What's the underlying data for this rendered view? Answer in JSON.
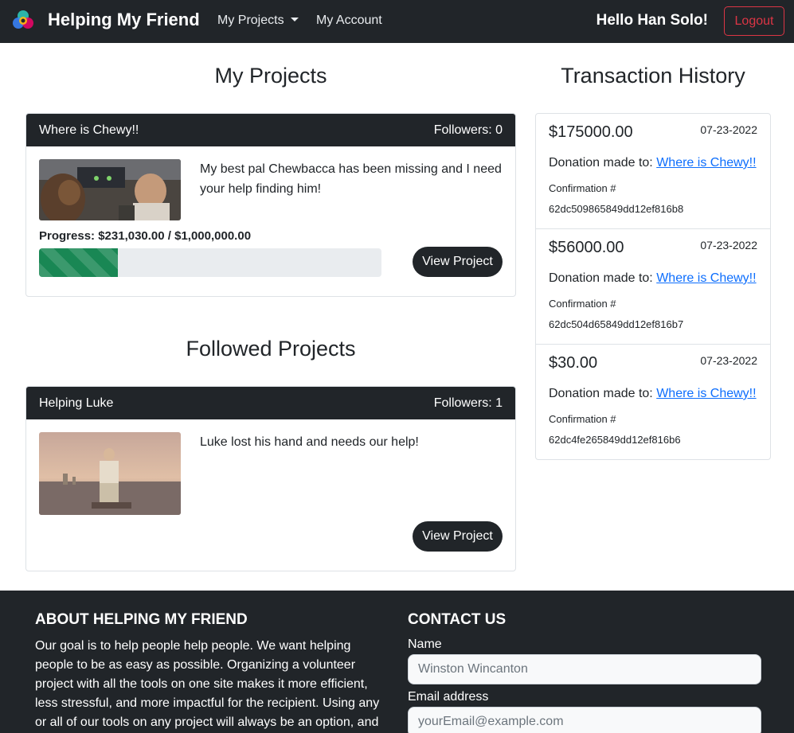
{
  "navbar": {
    "brand": "Helping My Friend",
    "my_projects": "My Projects",
    "my_account": "My Account",
    "greeting": "Hello Han Solo!",
    "logout": "Logout"
  },
  "my_projects": {
    "heading": "My Projects",
    "card": {
      "title": "Where is Chewy!!",
      "followers": "Followers: 0",
      "description": "My best pal Chewbacca has been missing and I need your help finding him!",
      "progress_label": "Progress: $231,030.00 / $1,000,000.00",
      "progress_fraction": 0.231,
      "view_button": "View Project"
    }
  },
  "followed_projects": {
    "heading": "Followed Projects",
    "card": {
      "title": "Helping Luke",
      "followers": "Followers: 1",
      "description": "Luke lost his hand and needs our help!",
      "view_button": "View Project"
    }
  },
  "transactions": {
    "heading": "Transaction History",
    "items": [
      {
        "amount": "$175000.00",
        "date": "07-23-2022",
        "made_to": "Donation made to:",
        "project_link": "Where is Chewy!!",
        "confirmation_label": "Confirmation #",
        "confirmation_id": "62dc509865849dd12ef816b8"
      },
      {
        "amount": "$56000.00",
        "date": "07-23-2022",
        "made_to": "Donation made to:",
        "project_link": "Where is Chewy!!",
        "confirmation_label": "Confirmation #",
        "confirmation_id": "62dc504d65849dd12ef816b7"
      },
      {
        "amount": "$30.00",
        "date": "07-23-2022",
        "made_to": "Donation made to:",
        "project_link": "Where is Chewy!!",
        "confirmation_label": "Confirmation #",
        "confirmation_id": "62dc4fe265849dd12ef816b6"
      }
    ]
  },
  "footer": {
    "about_heading": "ABOUT HELPING MY FRIEND",
    "about_text": "Our goal is to help people help people. We want helping people to be as easy as possible. Organizing a volunteer project with all the tools on one site makes it more efficient, less stressful, and more impactful for the recipient. Using any or all of our tools on any project will always be an option, and",
    "contact_heading": "CONTACT US",
    "name_label": "Name",
    "name_placeholder": "Winston Wincanton",
    "email_label": "Email address",
    "email_placeholder": "yourEmail@example.com"
  },
  "colors": {
    "navbar_bg": "#212529",
    "logout_red": "#dc3545",
    "progress_green": "#198754",
    "link_blue": "#0d6efd"
  }
}
